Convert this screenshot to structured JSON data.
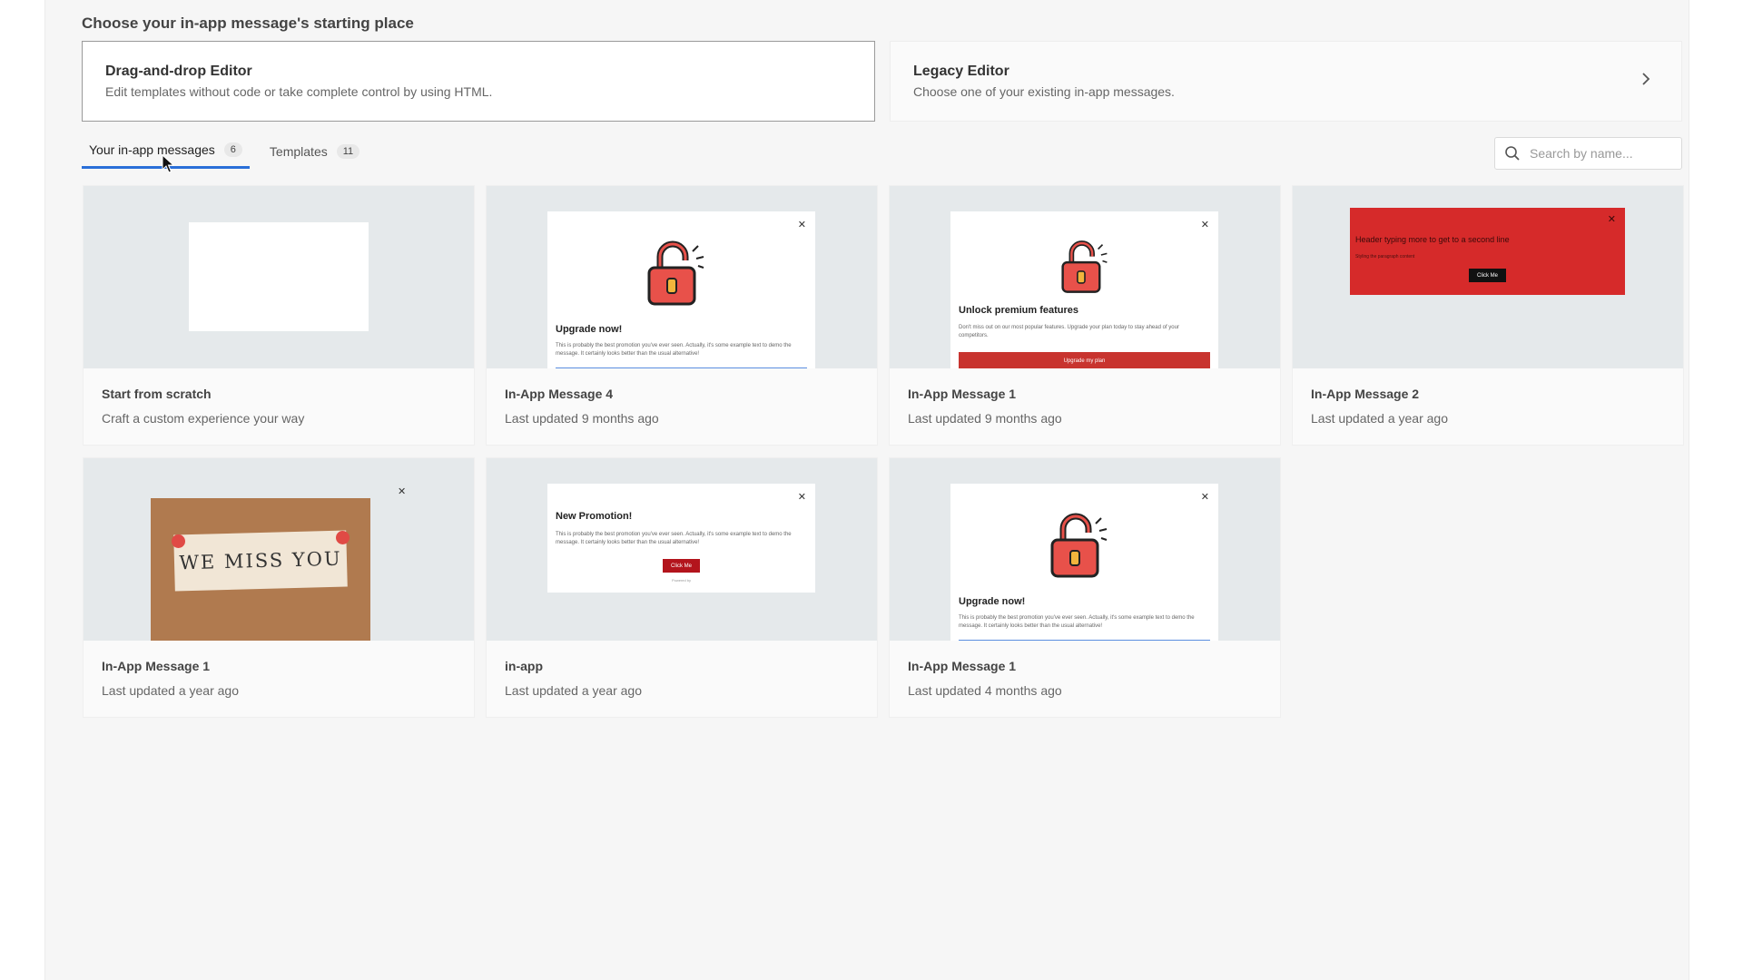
{
  "page": {
    "heading": "Choose your in-app message's starting place"
  },
  "editors": [
    {
      "title": "Drag-and-drop Editor",
      "description": "Edit templates without code or take complete control by using HTML."
    },
    {
      "title": "Legacy Editor",
      "description": "Choose one of your existing in-app messages."
    }
  ],
  "tabs": [
    {
      "label": "Your in-app messages",
      "count": "6"
    },
    {
      "label": "Templates",
      "count": "11"
    }
  ],
  "search": {
    "placeholder": "Search by name..."
  },
  "cards": [
    {
      "title": "Start from scratch",
      "subtitle": "Craft a custom experience your way"
    },
    {
      "title": "In-App Message 4",
      "subtitle": "Last updated 9 months ago",
      "preview": {
        "heading": "Upgrade now!",
        "body": "This is probably the best promotion you've ever seen. Actually, it's some example text to demo the message. It certainly looks better than the usual alternative!"
      }
    },
    {
      "title": "In-App Message 1",
      "subtitle": "Last updated 9 months ago",
      "preview": {
        "heading": "Unlock premium features",
        "body": "Don't miss out on our most popular features. Upgrade your plan today to stay ahead of your competitors.",
        "button": "Upgrade my plan"
      }
    },
    {
      "title": "In-App Message 2",
      "subtitle": "Last updated a year ago",
      "preview": {
        "heading": "Header typing more to get to a second line",
        "body": "Styling the paragraph content",
        "button": "Click Me"
      }
    },
    {
      "title": "In-App Message 1",
      "subtitle": "Last updated a year ago",
      "preview": {
        "image_text": "WE MISS YOU"
      }
    },
    {
      "title": "in-app",
      "subtitle": "Last updated a year ago",
      "preview": {
        "heading": "New Promotion!",
        "body": "This is probably the best promotion you've ever seen. Actually, it's some example text to demo the message. It certainly looks better than the usual alternative!",
        "button": "Click Me",
        "footer": "Powered by"
      }
    },
    {
      "title": "In-App Message 1",
      "subtitle": "Last updated 4 months ago",
      "preview": {
        "heading": "Upgrade now!",
        "body": "This is probably the best promotion you've ever seen. Actually, it's some example text to demo the message. It certainly looks better than the usual alternative!"
      }
    }
  ],
  "colors": {
    "accent": "#2a6fd8",
    "promo_red": "#d62a2a",
    "button_red": "#c8342f"
  }
}
